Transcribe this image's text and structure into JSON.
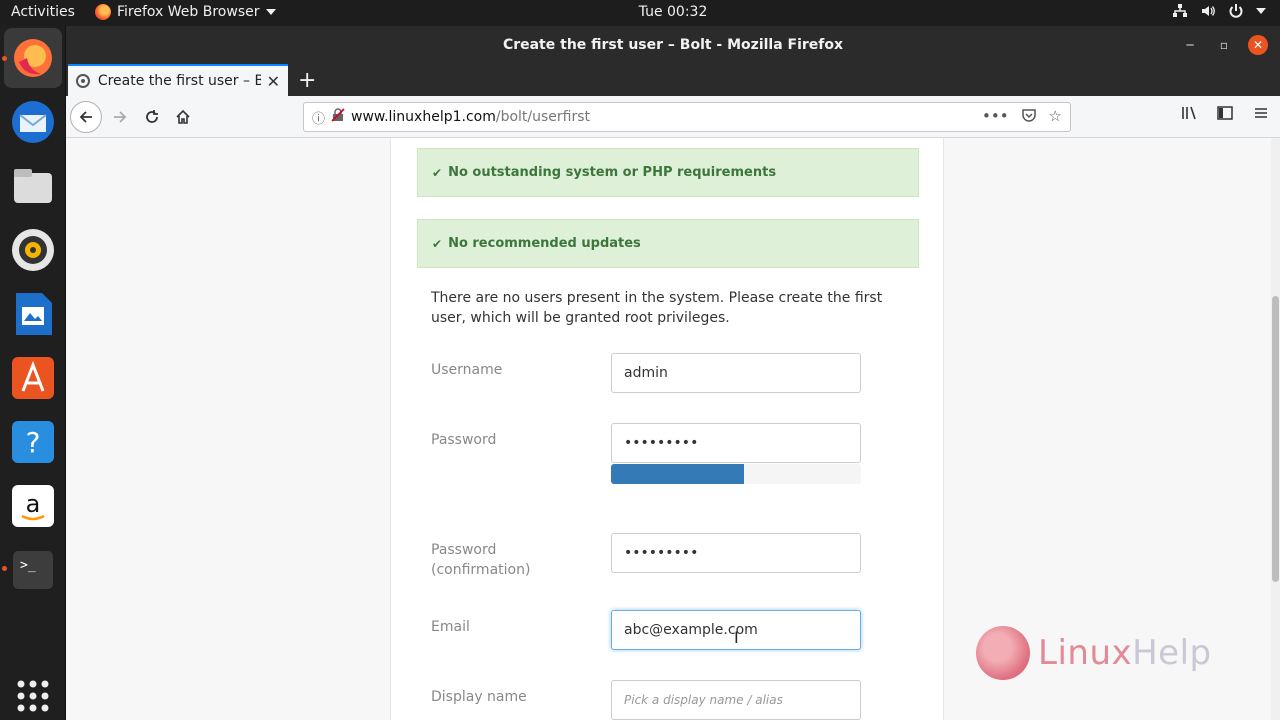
{
  "topbar": {
    "activities": "Activities",
    "app_name": "Firefox Web Browser",
    "clock": "Tue 00:32"
  },
  "window": {
    "title": "Create the first user – Bolt - Mozilla Firefox"
  },
  "tab": {
    "title": "Create the first user – Bo"
  },
  "address": {
    "host": "www.linuxhelp1.com",
    "path": "/bolt/userfirst"
  },
  "page": {
    "alert_requirements": "No outstanding system or PHP requirements",
    "alert_updates": "No recommended updates",
    "intro": "There are no users present in the system. Please create the first user, which will be granted root privileges.",
    "form": {
      "username_label": "Username",
      "username_value": "admin",
      "password_label": "Password",
      "password_value": "•••••••••",
      "password_strength_percent": 53,
      "confirm_label_1": "Password",
      "confirm_label_2": "(confirmation)",
      "confirm_value": "•••••••••",
      "email_label": "Email",
      "email_value": "abc@example.com",
      "display_label": "Display name",
      "display_placeholder": "Pick a display name / alias"
    }
  },
  "watermark": {
    "part1": "Linux",
    "part2": "Help"
  },
  "colors": {
    "accent": "#e95420",
    "alert_bg": "#dff0d8",
    "alert_text": "#3c763d",
    "strength": "#337ab7",
    "focus": "#66afe9"
  }
}
